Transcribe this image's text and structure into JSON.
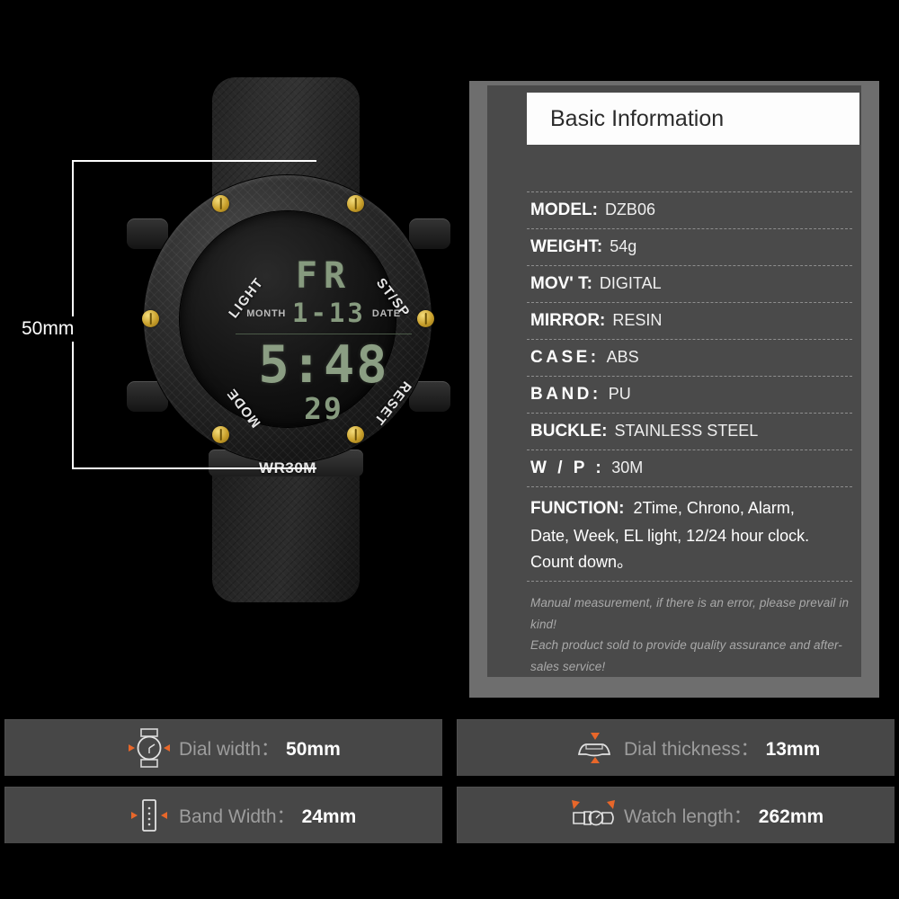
{
  "product_photo": {
    "dimension_callout": "50mm",
    "watch": {
      "bezel_labels": {
        "top_left": "LIGHT",
        "top_right": "ST/SP",
        "bottom_left": "MODE",
        "bottom_right": "RESET",
        "bottom_center": "WR30M"
      },
      "lcd": {
        "weekday": "FR",
        "month_label": "MONTH",
        "date_label": "DATE",
        "month_date": "1-13",
        "time": "5:48",
        "seconds": "29"
      }
    }
  },
  "panel": {
    "header_title": "Basic Information",
    "specs": [
      {
        "key": "MODEL:",
        "value": "DZB06",
        "spaced": false
      },
      {
        "key": "WEIGHT:",
        "value": "54g",
        "spaced": false
      },
      {
        "key": "MOV' T:",
        "value": "DIGITAL",
        "spaced": false
      },
      {
        "key": "MIRROR:",
        "value": "RESIN",
        "spaced": false
      },
      {
        "key": "CASE:",
        "value": "ABS",
        "spaced": true
      },
      {
        "key": "BAND:",
        "value": "PU",
        "spaced": true
      },
      {
        "key": "BUCKLE:",
        "value": "STAINLESS STEEL",
        "spaced": false
      },
      {
        "key": "W / P :",
        "value": "30M",
        "spaced": true
      }
    ],
    "function": {
      "key": "FUNCTION:",
      "line1": "2Time, Chrono, Alarm,",
      "line2": "Date, Week, EL light, 12/24 hour clock.",
      "line3": "Count down。"
    },
    "notes": [
      "Manual measurement, if there is an error, please prevail in kind!",
      "Each product sold to provide quality assurance and after-sales service!"
    ]
  },
  "measurements": [
    {
      "icon": "watch-face-icon",
      "label": "Dial width：",
      "value": "50mm"
    },
    {
      "icon": "watch-band-icon",
      "label": "Band Width：",
      "value": "24mm"
    },
    {
      "icon": "watch-thickness-icon",
      "label": "Dial thickness：",
      "value": "13mm"
    },
    {
      "icon": "watch-length-icon",
      "label": "Watch length：",
      "value": "262mm"
    }
  ],
  "colors": {
    "background": "#000000",
    "panel_frame": "#6e6e6e",
    "panel_card": "#4a4a4a",
    "header_bg": "#fdfdfd",
    "bar_bg": "#474747",
    "accent_orange": "#e8672a",
    "lcd_green": "#869a7e"
  }
}
